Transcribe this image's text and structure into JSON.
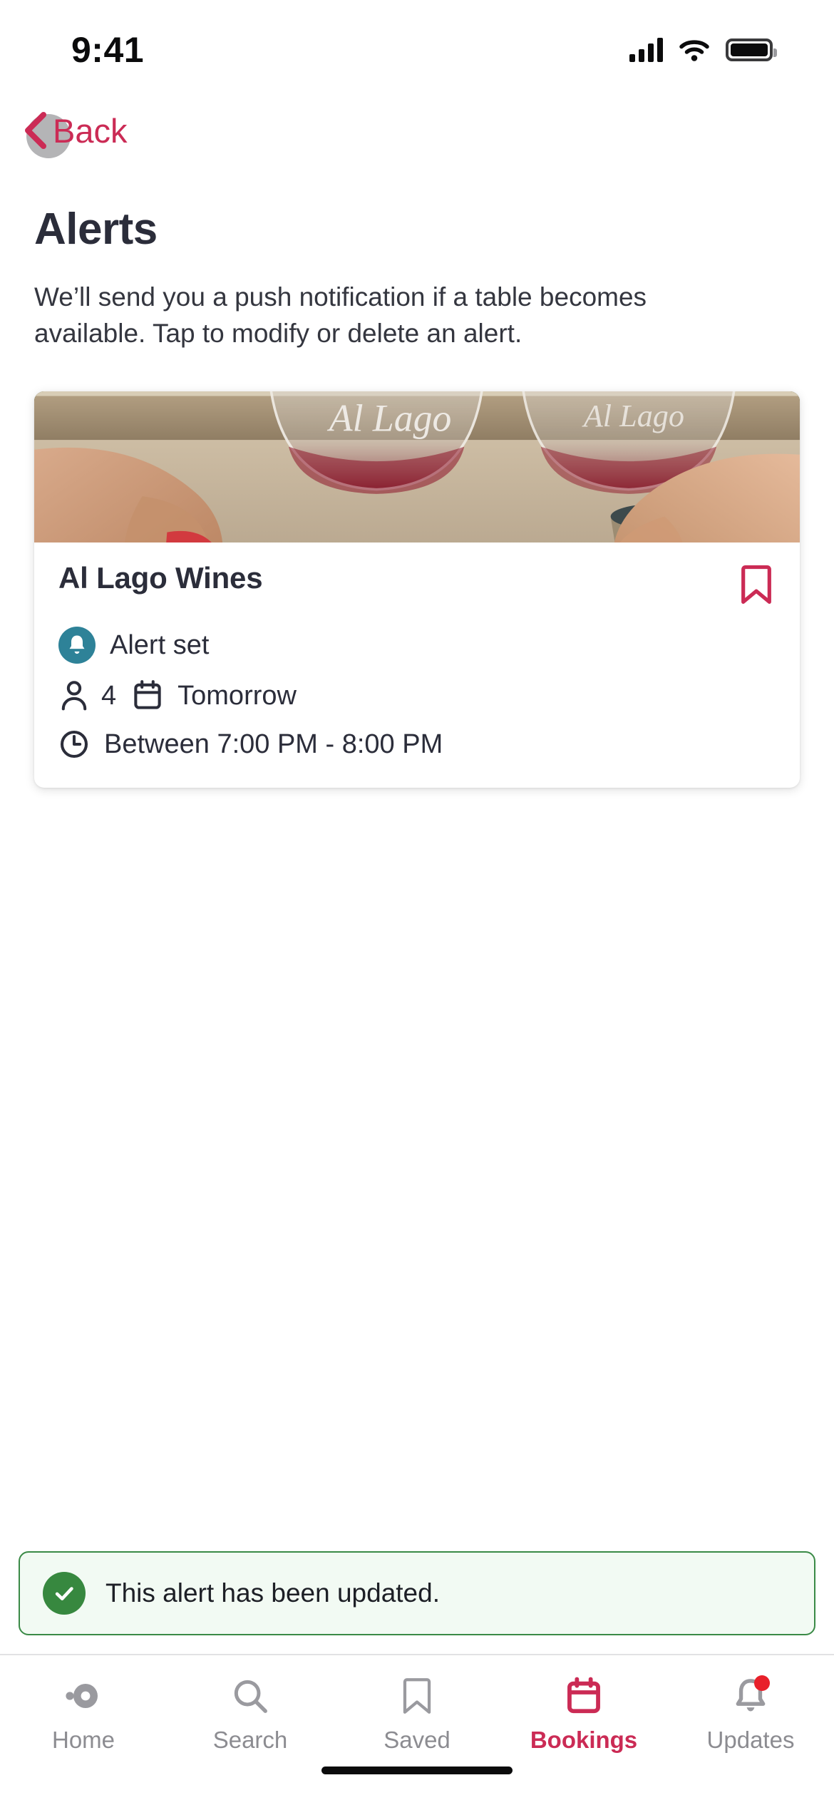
{
  "status_bar": {
    "time": "9:41",
    "cellular_icon": "cellular-bars-icon",
    "wifi_icon": "wifi-icon",
    "battery_icon": "battery-full-icon"
  },
  "nav": {
    "back_label": "Back",
    "back_icon": "chevron-left-icon",
    "accent_color": "#CB2B55"
  },
  "header": {
    "title": "Alerts",
    "description": "We’ll send you a push notification if a table becomes available. Tap to modify or delete an alert."
  },
  "alert_card": {
    "image_alt": "two wine glasses toasting on a patio",
    "restaurant_name": "Al Lago Wines",
    "bookmark_icon": "bookmark-icon",
    "bookmark_color": "#CB2B55",
    "status": {
      "icon": "bell-icon",
      "icon_bg": "#2E8298",
      "label": "Alert set"
    },
    "party": {
      "icon": "person-icon",
      "size": "4"
    },
    "date": {
      "icon": "calendar-icon",
      "label": "Tomorrow"
    },
    "time": {
      "icon": "clock-icon",
      "label": "Between 7:00 PM - 8:00 PM"
    }
  },
  "toast": {
    "icon": "check-circle-icon",
    "message": "This alert has been updated.",
    "border_color": "#3A8A46",
    "background_color": "#F2FAF3"
  },
  "tabbar": {
    "items": [
      {
        "label": "Home",
        "icon": "home-icon",
        "active": false
      },
      {
        "label": "Search",
        "icon": "search-icon",
        "active": false
      },
      {
        "label": "Saved",
        "icon": "bookmark-icon",
        "active": false
      },
      {
        "label": "Bookings",
        "icon": "calendar-icon",
        "active": true
      },
      {
        "label": "Updates",
        "icon": "bell-icon",
        "active": false,
        "badge": true
      }
    ],
    "active_color": "#CB2B55",
    "inactive_color": "#8c8c91"
  }
}
